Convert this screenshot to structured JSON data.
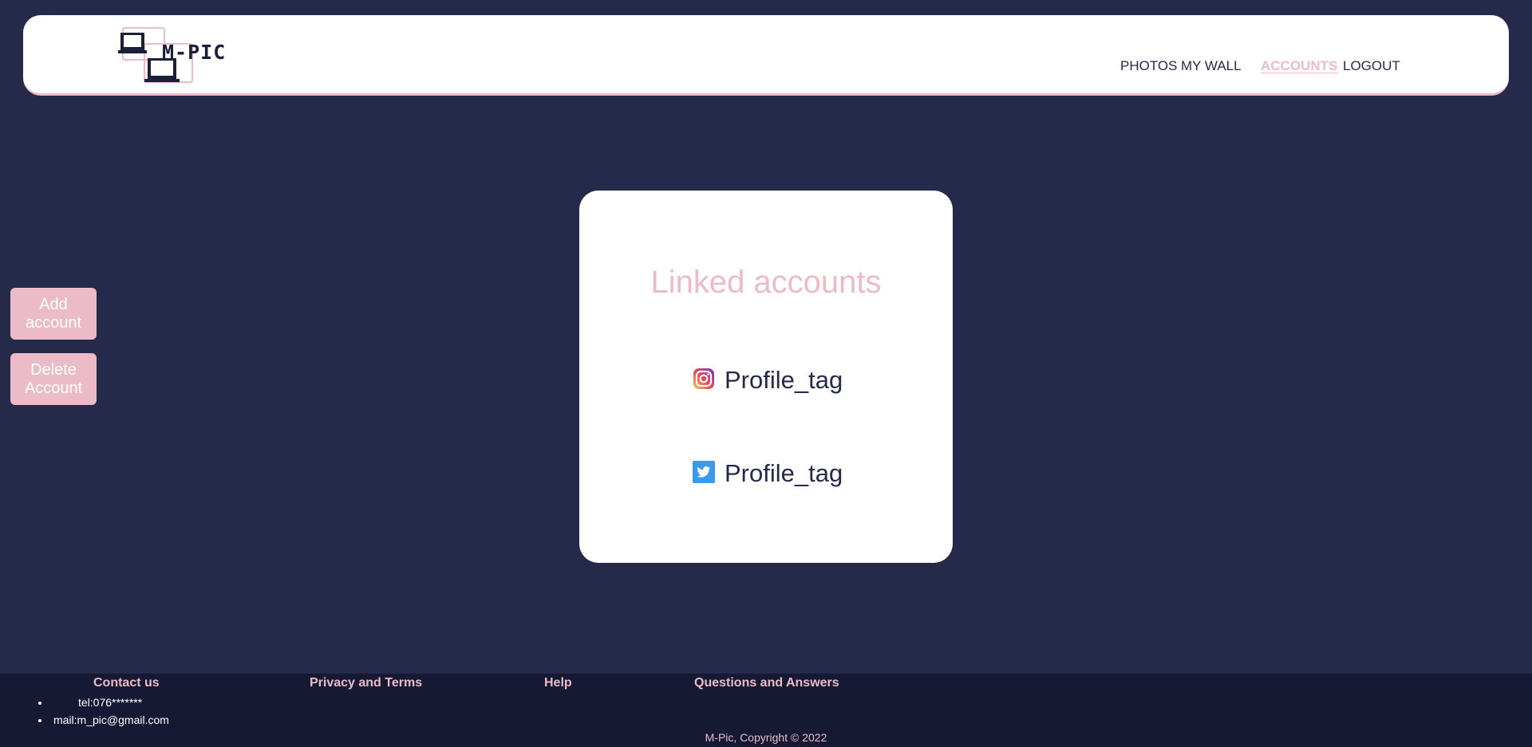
{
  "app": {
    "brand": "M-PIC"
  },
  "nav": {
    "items": [
      {
        "label": "PHOTOS",
        "active": false
      },
      {
        "label": "MY WALL",
        "active": false
      },
      {
        "label": "ACCOUNTS",
        "active": true
      },
      {
        "label": "LOGOUT",
        "active": false
      }
    ]
  },
  "sidebar": {
    "add_button": [
      "Add",
      "account"
    ],
    "delete_button": [
      "Delete",
      "Account"
    ]
  },
  "card": {
    "title": "Linked accounts",
    "accounts": [
      {
        "icon": "instagram-icon",
        "tag": "Profile_tag"
      },
      {
        "icon": "twitter-icon",
        "tag": "Profile_tag"
      }
    ]
  },
  "footer": {
    "contact_heading": "Contact us",
    "privacy": "Privacy and Terms",
    "help": "Help",
    "qa": "Questions and Answers",
    "contacts": [
      "tel:076*******",
      "mail:m_pic@gmail.com"
    ],
    "copyright": "M-Pic, Copyright © 2022"
  },
  "colors": {
    "background": "#262a4a",
    "accent_pink": "#ebbcc8",
    "footer_bg": "#151933",
    "card_bg": "#ffffff"
  }
}
